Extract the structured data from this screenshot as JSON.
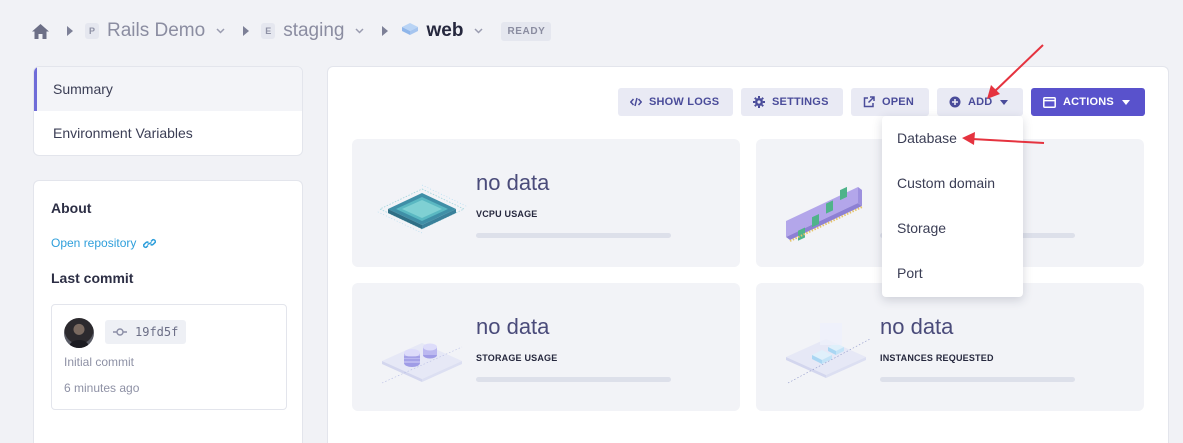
{
  "breadcrumb": {
    "project_badge": "P",
    "project": "Rails Demo",
    "environment_badge": "E",
    "environment": "staging",
    "service": "web",
    "status": "READY"
  },
  "sidebar": {
    "nav": [
      {
        "label": "Summary",
        "active": true
      },
      {
        "label": "Environment Variables",
        "active": false
      }
    ],
    "about": {
      "title": "About",
      "repo_link": "Open repository",
      "last_commit_title": "Last commit",
      "commit": {
        "sha": "19fd5f",
        "message": "Initial commit",
        "time": "6 minutes ago"
      }
    }
  },
  "toolbar": {
    "show_logs": "SHOW LOGS",
    "settings": "SETTINGS",
    "open": "OPEN",
    "add": "ADD",
    "actions": "ACTIONS"
  },
  "metrics": [
    {
      "value": "no data",
      "label": "VCPU USAGE",
      "icon": "cpu-chip-icon"
    },
    {
      "value": "",
      "label": "",
      "icon": "memory-module-icon"
    },
    {
      "value": "no data",
      "label": "STORAGE USAGE",
      "icon": "storage-disks-icon"
    },
    {
      "value": "no data",
      "label": "INSTANCES REQUESTED",
      "icon": "instances-icon"
    }
  ],
  "add_menu": {
    "items": [
      "Database",
      "Custom domain",
      "Storage",
      "Port"
    ]
  },
  "colors": {
    "primary": "#5952cc",
    "accent_nav": "#6f6cd8",
    "link": "#2f9fdb",
    "annotation_arrow": "#e5333f"
  }
}
